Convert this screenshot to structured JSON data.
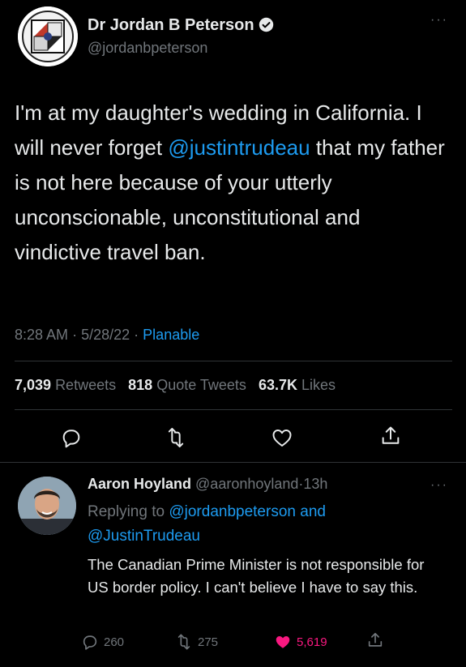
{
  "tweet": {
    "author_name": "Dr Jordan B Peterson",
    "handle": "@jordanbpeterson",
    "more": "···",
    "text_part1": "I'm at my daughter's wedding in California. I will never forget ",
    "mention": "@justintrudeau",
    "text_part2": " that my father is not here because of your utterly unconscionable, unconstitutional and vindictive travel ban.",
    "time": "8:28 AM",
    "date": "5/28/22",
    "dot": "·",
    "source": "Planable",
    "retweets_count": "7,039",
    "retweets_label": "Retweets",
    "quotes_count": "818",
    "quotes_label": "Quote Tweets",
    "likes_count": "63.7K",
    "likes_label": "Likes"
  },
  "reply": {
    "author_name": "Aaron Hoyland",
    "handle": "@aaronhoyland",
    "age": "13h",
    "dot": "·",
    "more": "···",
    "replying_prefix": "Replying to ",
    "replying_to1": "@jordanbpeterson",
    "replying_and": " and",
    "replying_to2": "@JustinTrudeau",
    "text": "The Canadian Prime Minister is not responsible for US border policy. I can't believe I have to say this.",
    "replies": "260",
    "retweets": "275",
    "likes": "5,619"
  },
  "colors": {
    "background": "#000000",
    "text": "#e7e9ea",
    "secondary": "#71767b",
    "accent": "#1d9bf0",
    "like": "#f91880"
  }
}
